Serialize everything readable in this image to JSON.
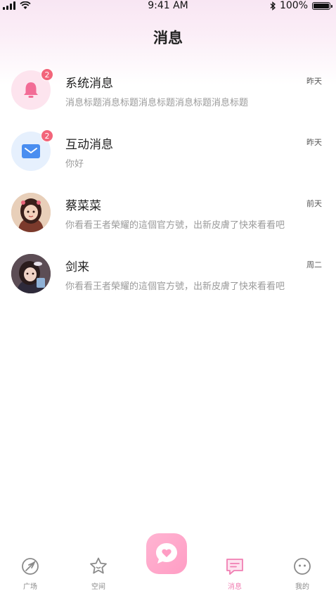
{
  "status_bar": {
    "time": "9:41 AM",
    "battery": "100%",
    "battery_level": 1.0
  },
  "header": {
    "title": "消息"
  },
  "messages": [
    {
      "title": "系统消息",
      "preview": "消息标题消息标题消息标题消息标题消息标题",
      "time": "昨天",
      "badge": "2",
      "avatar_icon": "bell-icon",
      "avatar_bg": "#fde4ee",
      "icon_color": "#f26c96"
    },
    {
      "title": "互动消息",
      "preview": "你好",
      "time": "昨天",
      "badge": "2",
      "avatar_icon": "mail-icon",
      "avatar_bg": "#e6f0fd",
      "icon_color": "#4a8ef0"
    },
    {
      "title": "蔡菜菜",
      "preview": "你看看王者榮耀的這個官方號，出新皮膚了快來看看吧",
      "time": "前天",
      "badge": "",
      "avatar_icon": "user-avatar"
    },
    {
      "title": "剑来",
      "preview": "你看看王者榮耀的這個官方號，出新皮膚了快來看看吧",
      "time": "周二",
      "badge": "",
      "avatar_icon": "user-avatar"
    }
  ],
  "tab_bar": {
    "tabs": [
      {
        "label": "广场",
        "icon": "leaf-icon",
        "active": false
      },
      {
        "label": "空间",
        "icon": "star-icon",
        "active": false
      },
      {
        "label": "",
        "icon": "heart-chat-icon",
        "active": false
      },
      {
        "label": "消息",
        "icon": "message-icon",
        "active": true
      },
      {
        "label": "我的",
        "icon": "face-icon",
        "active": false
      }
    ],
    "accent_color": "#f07fb3"
  }
}
